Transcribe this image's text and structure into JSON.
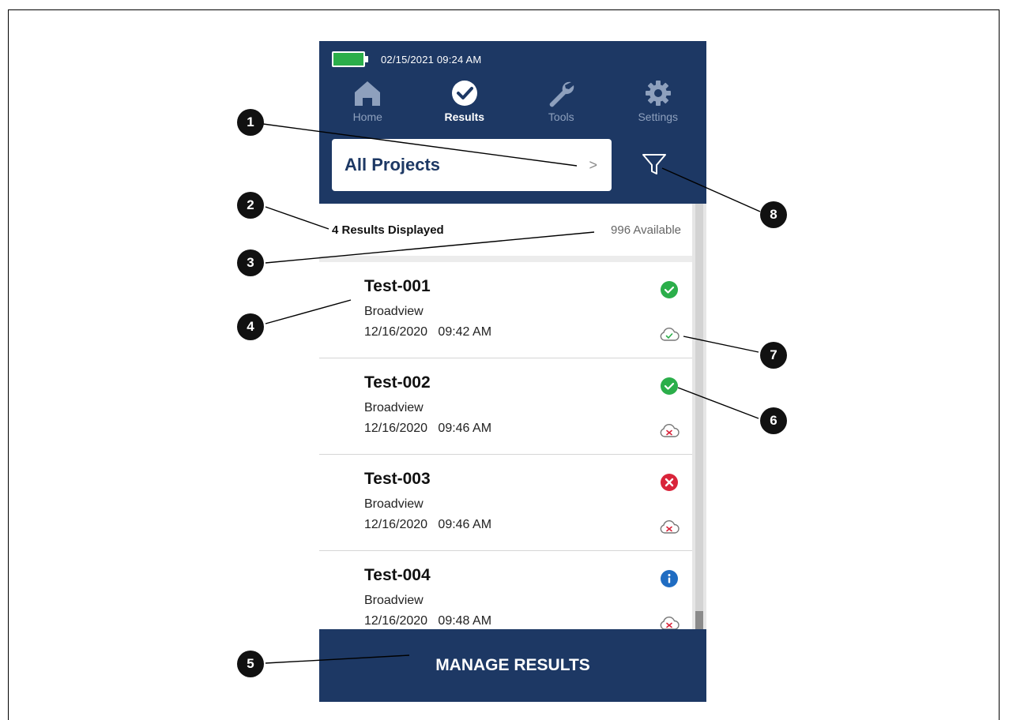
{
  "status_bar": {
    "datetime": "02/15/2021  09:24  AM"
  },
  "nav": [
    {
      "label": "Home",
      "icon": "home-icon",
      "active": false
    },
    {
      "label": "Results",
      "icon": "check-circle-icon",
      "active": true
    },
    {
      "label": "Tools",
      "icon": "wrench-icon",
      "active": false
    },
    {
      "label": "Settings",
      "icon": "gear-icon",
      "active": false
    }
  ],
  "project_selector": {
    "label": "All Projects",
    "chevron": ">"
  },
  "summary": {
    "displayed": "4 Results Displayed",
    "available": "996 Available"
  },
  "results": [
    {
      "name": "Test-001",
      "location": "Broadview",
      "datetime": "12/16/2020   09:42 AM",
      "status": "pass",
      "sync": "synced"
    },
    {
      "name": "Test-002",
      "location": "Broadview",
      "datetime": "12/16/2020   09:46 AM",
      "status": "pass",
      "sync": "not-synced"
    },
    {
      "name": "Test-003",
      "location": "Broadview",
      "datetime": "12/16/2020   09:46 AM",
      "status": "fail",
      "sync": "not-synced"
    },
    {
      "name": "Test-004",
      "location": "Broadview",
      "datetime": "12/16/2020   09:48 AM",
      "status": "info",
      "sync": "not-synced"
    }
  ],
  "manage_button": {
    "label": "MANAGE RESULTS"
  },
  "callouts": [
    "1",
    "2",
    "3",
    "4",
    "5",
    "6",
    "7",
    "8"
  ],
  "colors": {
    "header_bg": "#1d3864",
    "pass": "#2bae4a",
    "fail": "#d9243a",
    "info": "#1f6cc2",
    "battery": "#2bae4a"
  }
}
